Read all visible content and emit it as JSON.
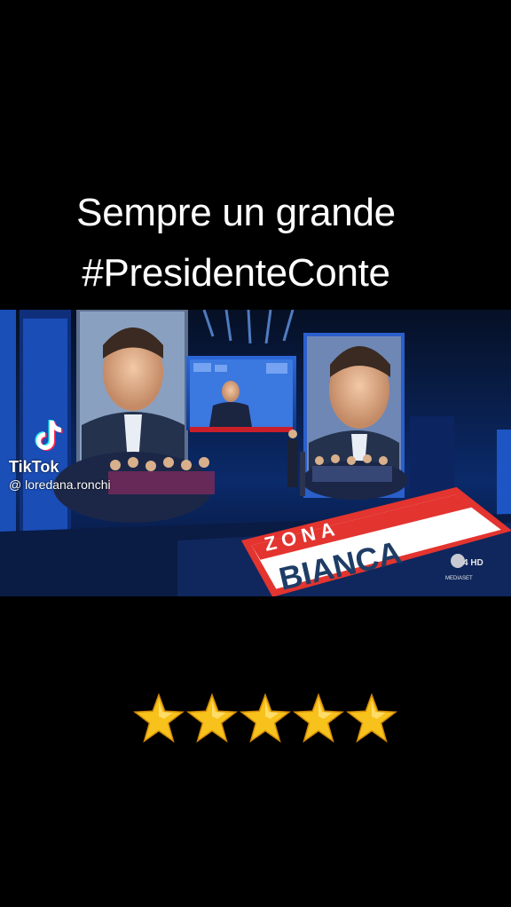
{
  "caption": {
    "line1": "Sempre un grande",
    "line2": "#PresidenteConte"
  },
  "watermark": {
    "brand": "TikTok",
    "username": "@ loredana.ronchi",
    "icon": "tiktok-logo-icon"
  },
  "video": {
    "floor_logo_top": "ZONA",
    "floor_logo_bottom": "BIANCA",
    "channel_badge": "4 HD",
    "channel_sub": "MEDIASET"
  },
  "rating": {
    "stars": 5,
    "icon": "star-icon",
    "color": "#f7c21b"
  },
  "colors": {
    "background": "#000000",
    "caption": "#ffffff",
    "studio_blue": "#1f5bd6",
    "logo_red": "#e3342f"
  }
}
